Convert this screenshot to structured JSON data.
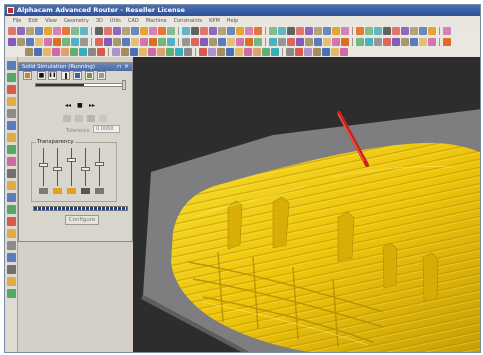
{
  "window": {
    "title": "Alphacam Advanced Router - Reseller License"
  },
  "menu": [
    "File",
    "Edit",
    "View",
    "Geometry",
    "3D",
    "Utils",
    "CAD",
    "Machine",
    "Constraints",
    "KPM",
    "Help"
  ],
  "panel": {
    "title": "Solid Simulation (Running)",
    "pin_glyph": "⊓",
    "close_glyph": "×",
    "tolerance_label": "Tolerance",
    "tolerance_value": "0.0060",
    "transparency_label": "Transparency",
    "configure_label": "Configure",
    "progress_fraction": 0.55,
    "transparency_levels": [
      0.55,
      0.45,
      0.7,
      0.45,
      0.6
    ],
    "controls": {
      "stop": "■",
      "pause": "❚❚",
      "rewind": "◂◂",
      "step": "■",
      "forward": "▸▸"
    }
  },
  "colors": {
    "viewport_bg": "#2d2d2d",
    "stock_grey": "#7e7e80",
    "model_gold": "#f2cf0a",
    "tool_red": "#c8221e",
    "title_blue": "#2c4f96"
  },
  "icons": [
    "open-icon",
    "save-icon",
    "undo-icon",
    "redo-icon",
    "zoom-icon",
    "pan-icon",
    "rotate-icon",
    "circle-icon",
    "line-icon",
    "arc-icon",
    "polyline-icon",
    "move-icon",
    "delete-icon",
    "layer-icon",
    "simulate-icon"
  ]
}
